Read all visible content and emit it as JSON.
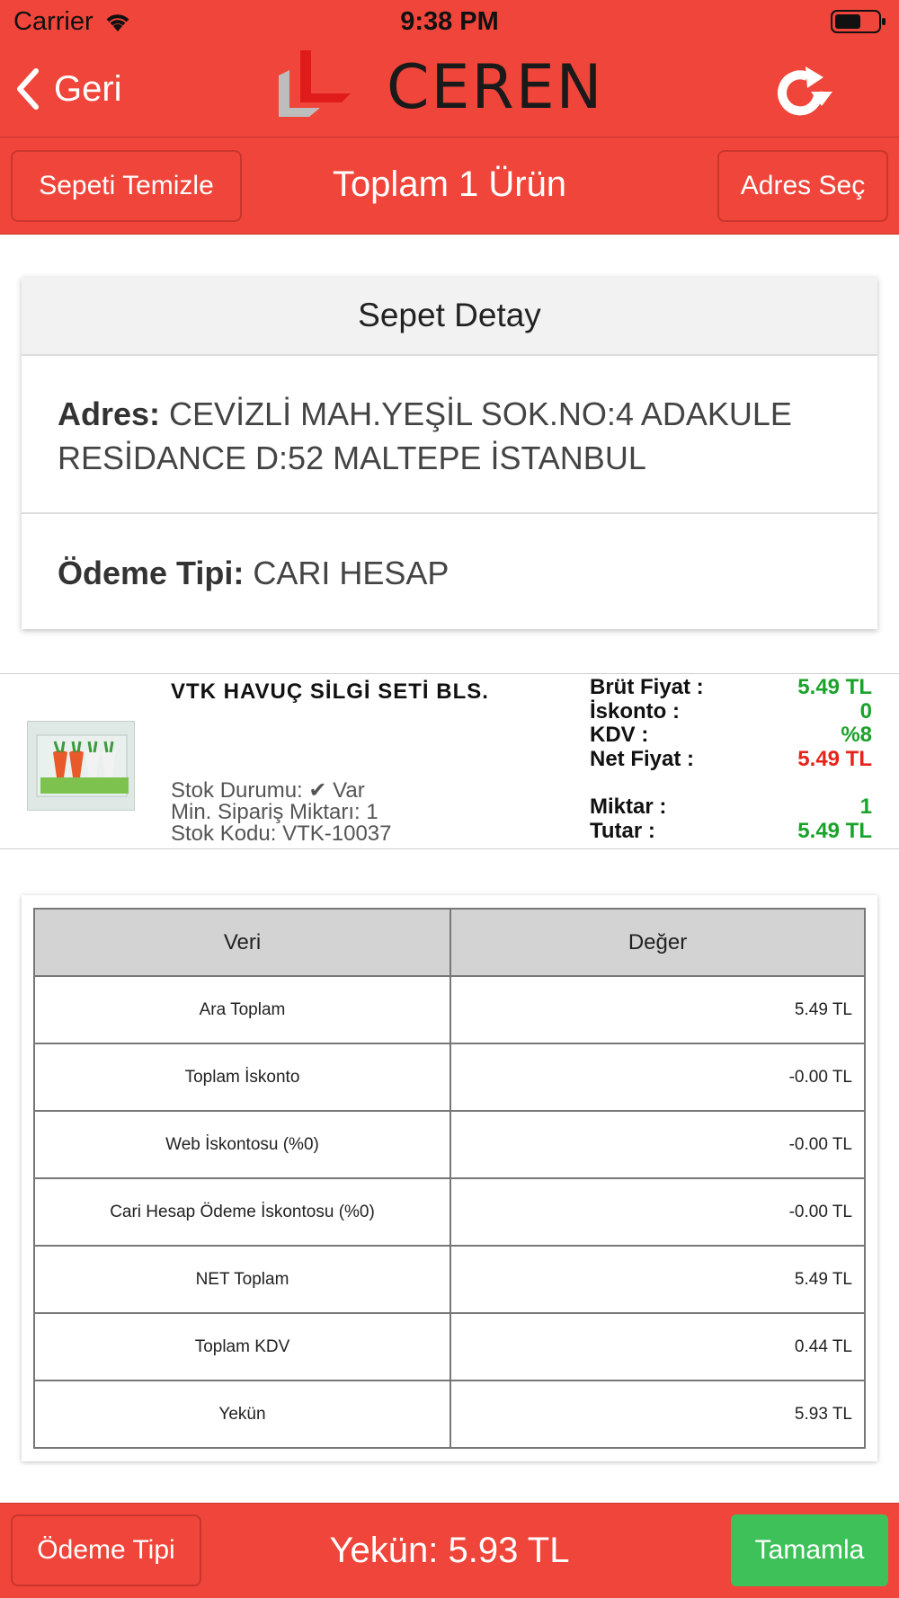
{
  "status_bar": {
    "carrier": "Carrier",
    "time": "9:38 PM"
  },
  "nav": {
    "back_label": "Geri",
    "logo_text": "CEREN"
  },
  "toolbar": {
    "clear_cart_label": "Sepeti Temizle",
    "title": "Toplam 1 Ürün",
    "select_address_label": "Adres Seç"
  },
  "detail": {
    "header": "Sepet Detay",
    "address_label": "Adres:",
    "address_value": "CEVİZLİ MAH.YEŞİL SOK.NO:4 ADAKULE RESİDANCE D:52 MALTEPE İSTANBUL",
    "payment_label": "Ödeme Tipi:",
    "payment_value": "CARI HESAP"
  },
  "product": {
    "name": "VTK HAVUÇ SİLGİ SETİ BLS.",
    "stock_status": "Stok Durumu: ✔ Var",
    "min_order": "Min. Sipariş Miktarı: 1",
    "stock_code": "Stok Kodu: VTK-10037",
    "gross_price_label": "Brüt Fiyat :",
    "gross_price": "5.49 TL",
    "discount_label": "İskonto :",
    "discount": "0",
    "vat_label": "KDV :",
    "vat": "%8",
    "net_price_label": "Net Fiyat :",
    "net_price": "5.49 TL",
    "quantity_label": "Miktar :",
    "quantity": "1",
    "amount_label": "Tutar :",
    "amount": "5.49 TL"
  },
  "summary": {
    "headers": [
      "Veri",
      "Değer"
    ],
    "rows": [
      {
        "key": "Ara Toplam",
        "value": "5.49 TL"
      },
      {
        "key": "Toplam İskonto",
        "value": "-0.00 TL"
      },
      {
        "key": "Web İskontosu (%0)",
        "value": "-0.00 TL"
      },
      {
        "key": "Cari Hesap Ödeme İskontosu (%0)",
        "value": "-0.00 TL"
      },
      {
        "key": "NET Toplam",
        "value": "5.49 TL"
      },
      {
        "key": "Toplam KDV",
        "value": "0.44 TL"
      },
      {
        "key": "Yekün",
        "value": "5.93 TL"
      }
    ]
  },
  "bottom": {
    "payment_type_label": "Ödeme Tipi",
    "total_text": "Yekün: 5.93 TL",
    "complete_label": "Tamamla"
  },
  "colors": {
    "brand_red": "#f0453a",
    "price_green": "#1aa32a",
    "price_red": "#e8231c",
    "complete_green": "#3fc15a"
  }
}
